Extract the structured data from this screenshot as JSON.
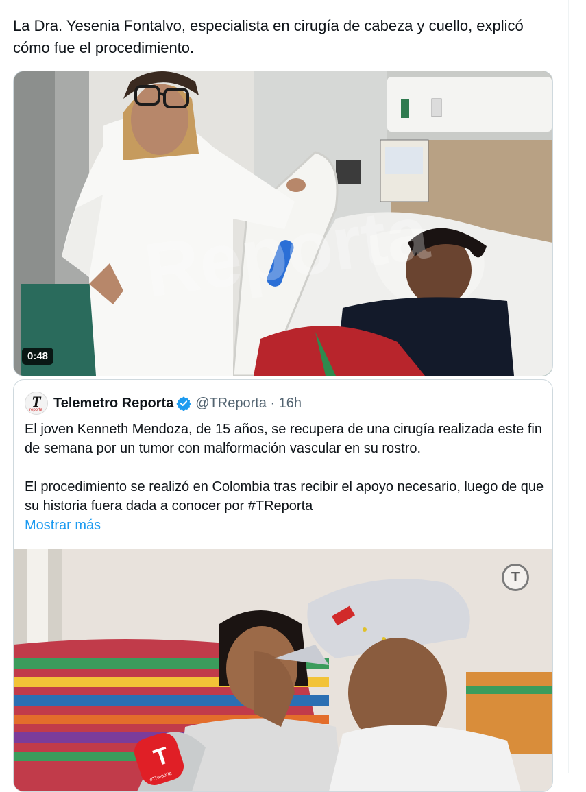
{
  "tweet": {
    "text": "La Dra. Yesenia Fontalvo, especialista en cirugía de cabeza y cuello, explicó cómo fue el procedimiento."
  },
  "video": {
    "duration": "0:48"
  },
  "quoted_tweet": {
    "author_name": "Telemetro Reporta",
    "handle_time": "@TReporta · 16h",
    "avatar_letter": "T",
    "avatar_caption": "reporta",
    "paragraph_1": "El joven Kenneth Mendoza, de 15 años, se recupera de una cirugía realizada este fin de semana por un tumor con malformación vascular en su rostro.",
    "paragraph_2": "El procedimiento se realizó en Colombia tras recibir el apoyo necesario, luego de que su historia fuera dada a conocer por #TReporta",
    "show_more": "Mostrar más",
    "photo_logo": "T",
    "mic_logo": "T",
    "mic_caption": "#TReporta"
  },
  "colors": {
    "link": "#1d9bf0",
    "verified": "#1d9bf0",
    "border": "#cfd9de",
    "secondary_text": "#536471"
  }
}
